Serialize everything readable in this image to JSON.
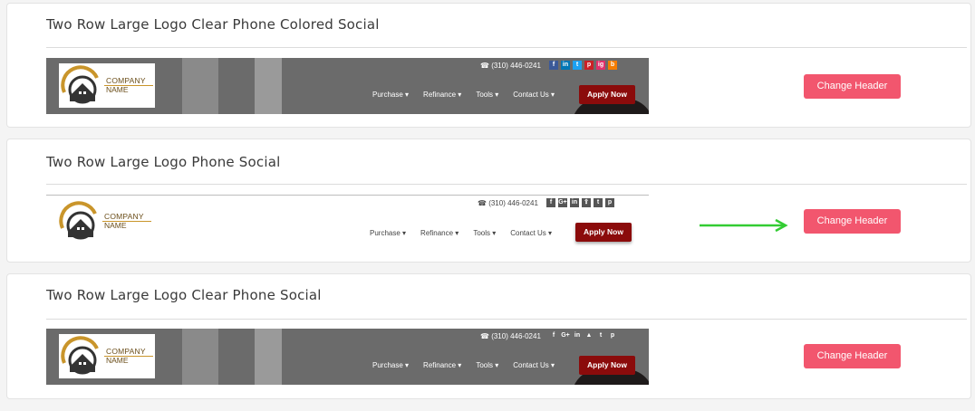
{
  "accent_color": "#f2566e",
  "arrow_color": "#33cc33",
  "cards": [
    {
      "title": "Two Row Large Logo Clear Phone Colored Social",
      "button_label": "Change Header",
      "preview": {
        "company": "COMPANY",
        "name": "NAME",
        "phone": "☎ (310) 446-0241",
        "social": [
          "f",
          "in",
          "t",
          "p",
          "ig",
          "b"
        ],
        "nav": [
          "Purchase ▾",
          "Refinance ▾",
          "Tools ▾",
          "Contact Us ▾"
        ],
        "cta": "Apply Now"
      }
    },
    {
      "title": "Two Row Large Logo Phone Social",
      "button_label": "Change Header",
      "preview": {
        "company": "COMPANY",
        "name": "NAME",
        "phone": "☎ (310) 446-0241",
        "social": [
          "f",
          "G+",
          "in",
          "⇪",
          "t",
          "p"
        ],
        "nav": [
          "Purchase ▾",
          "Refinance ▾",
          "Tools ▾",
          "Contact Us ▾"
        ],
        "cta": "Apply Now"
      }
    },
    {
      "title": "Two Row Large Logo Clear Phone Social",
      "button_label": "Change Header",
      "preview": {
        "company": "COMPANY",
        "name": "NAME",
        "phone": "☎ (310) 446-0241",
        "social": [
          "f",
          "G+",
          "in",
          "▲",
          "t",
          "p"
        ],
        "nav": [
          "Purchase ▾",
          "Refinance ▾",
          "Tools ▾",
          "Contact Us ▾"
        ],
        "cta": "Apply Now"
      }
    }
  ]
}
